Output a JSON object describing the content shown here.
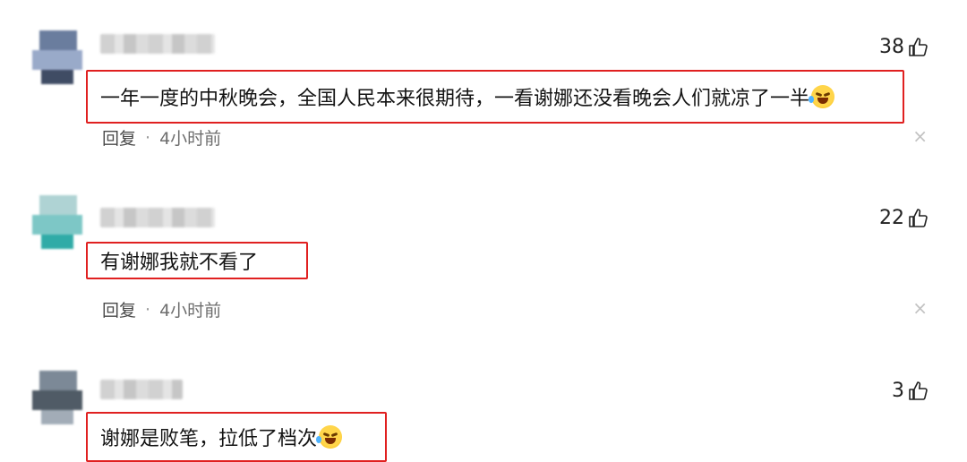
{
  "comments": [
    {
      "likes": "38",
      "text": "一年一度的中秋晚会，全国人民本来很期待，一看谢娜还没看晚会人们就凉了一半",
      "emoji": "laughing-crying-emoji",
      "reply_label": "回复",
      "separator": "·",
      "time": "4小时前",
      "close_glyph": "×",
      "avatar_colors": [
        "#5a6f94",
        "#8fa1c4",
        "#2b3954"
      ]
    },
    {
      "likes": "22",
      "text": "有谢娜我就不看了",
      "emoji": "",
      "reply_label": "回复",
      "separator": "·",
      "time": "4小时前",
      "close_glyph": "×",
      "avatar_colors": [
        "#a7cfd0",
        "#6fc2c0",
        "#1aa39e"
      ]
    },
    {
      "likes": "3",
      "text": "谢娜是败笔，拉低了档次",
      "emoji": "laughing-crying-emoji",
      "avatar_colors": [
        "#6e7d8c",
        "#3e4a56",
        "#98a4b0"
      ]
    }
  ],
  "accent_color": "#e02020"
}
